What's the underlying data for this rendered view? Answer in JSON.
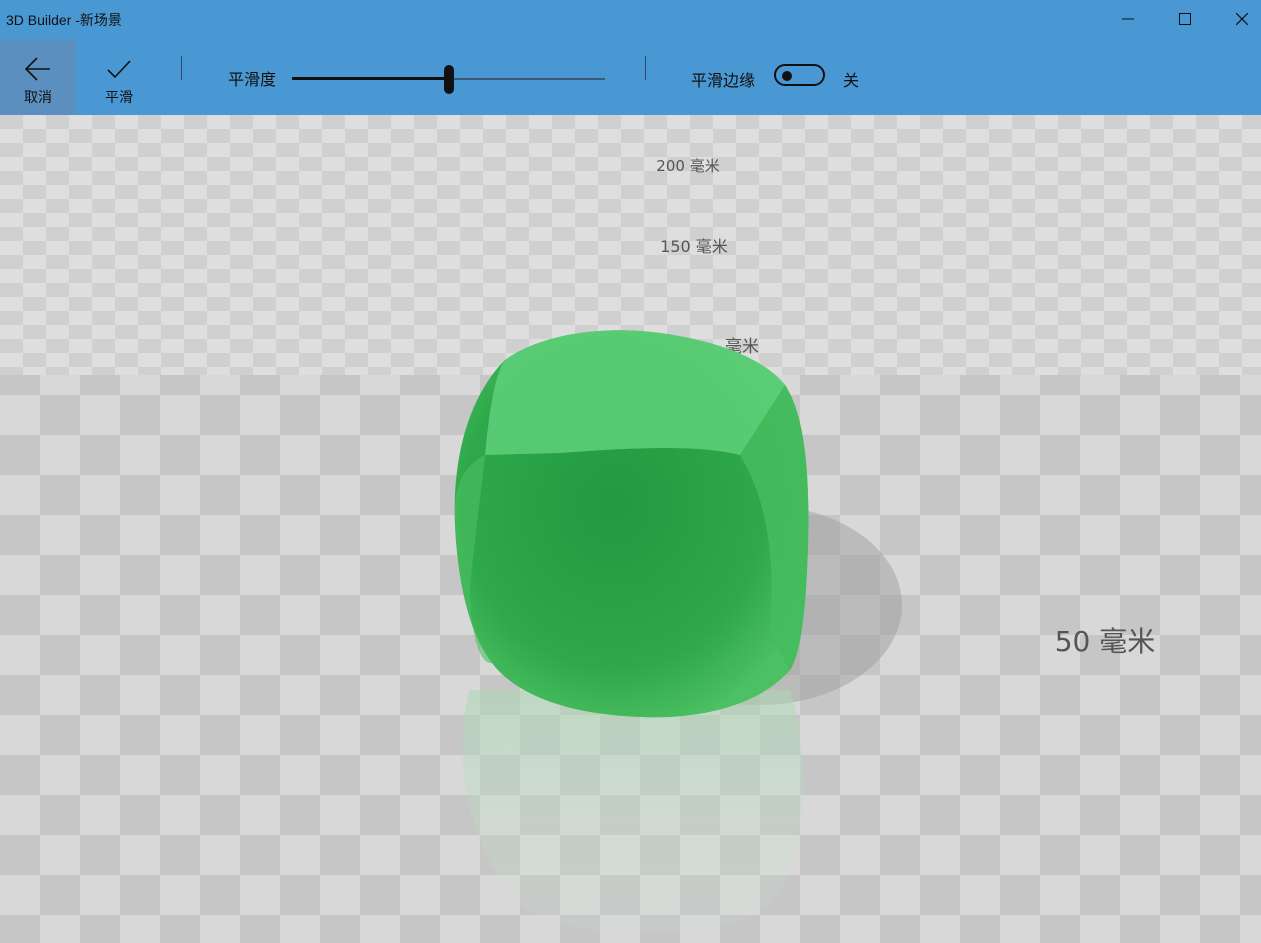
{
  "window": {
    "title": "3D Builder -新场景",
    "minimize_icon": "minimize-icon",
    "maximize_icon": "maximize-icon",
    "close_icon": "close-icon"
  },
  "toolbar": {
    "cancel_label": "取消",
    "cancel_icon": "arrow-left-icon",
    "smooth_label": "平滑",
    "smooth_icon": "checkmark-icon",
    "smoothness_label": "平滑度",
    "smoothness_value": 0.5,
    "smooth_edges_label": "平滑边缘",
    "smooth_edges_state": "关",
    "smooth_edges_on": false
  },
  "scene": {
    "rulers": [
      "200 毫米",
      "150 毫米",
      "毫米",
      "50 毫米"
    ],
    "object_color": "#2ea84a",
    "floor_colors": [
      "#d8d8d8",
      "#c4c4c4"
    ]
  },
  "colors": {
    "titlebar": "#4a98d3",
    "active_button": "#5b8fc0"
  }
}
